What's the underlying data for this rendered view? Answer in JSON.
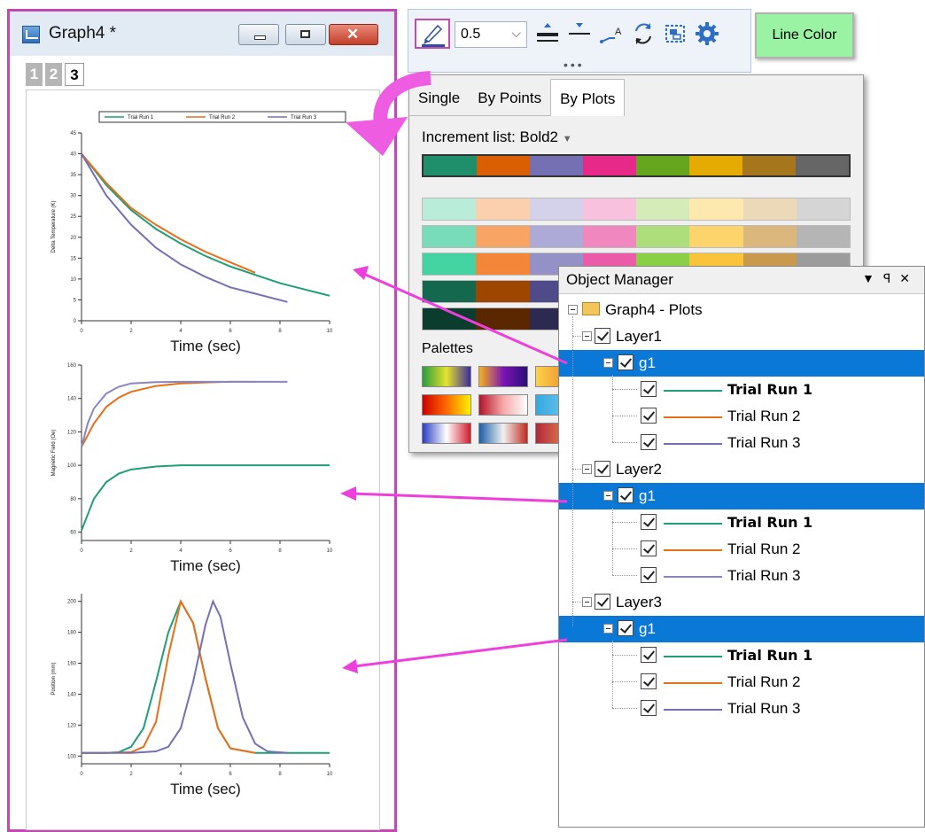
{
  "graph_window": {
    "title": "Graph4 *",
    "layer_tabs": [
      "1",
      "2",
      "3"
    ]
  },
  "style_toolbar": {
    "thickness": "0.5",
    "icons": [
      "pen-color-icon",
      "line-thicker-icon",
      "line-thinner-icon",
      "line-label-icon",
      "swap-icon",
      "group-icon",
      "settings-icon"
    ],
    "line_color_button": "Line Color"
  },
  "increment_panel": {
    "tabs": [
      "Single",
      "By Points",
      "By Plots"
    ],
    "active_tab": "By Plots",
    "increment_label": "Increment list: Bold2",
    "selected_list": [
      "#1f8e6a",
      "#d95f02",
      "#7570b3",
      "#e7298a",
      "#66a61e",
      "#e6ab02",
      "#a6761d",
      "#666666"
    ],
    "shade_rows": [
      [
        "#b9ecd9",
        "#fbd0ae",
        "#d4d2eb",
        "#f8c2de",
        "#d5ecb8",
        "#fde9ae",
        "#ecd9b7",
        "#d5d5d5"
      ],
      [
        "#78dcba",
        "#f7a465",
        "#aeaad8",
        "#f088bf",
        "#aedd7c",
        "#fcd46b",
        "#dcb77d",
        "#b5b5b5"
      ],
      [
        "#44d3a2",
        "#f4863a",
        "#9491c7",
        "#ec5ba7",
        "#8bcf45",
        "#f9c43a",
        "#c99a4e",
        "#9c9c9c"
      ],
      [
        "#14684d",
        "#9e4500",
        "#4f4a8a",
        "#ad1664",
        "#477a14",
        "#a97d01",
        "#7a5614",
        "#454545"
      ],
      [
        "#0a3d2d",
        "#5a2700",
        "#2d2a52",
        "#63093a",
        "#28440a",
        "#604700",
        "#44300b",
        "#242424"
      ]
    ],
    "palettes_label": "Palettes"
  },
  "object_manager": {
    "title": "Object Manager",
    "root": "Graph4 - Plots",
    "layers": [
      {
        "name": "Layer1",
        "group": "g1",
        "plots": [
          {
            "name": "Trial Run 1",
            "color": "#1f9e77",
            "bold": true
          },
          {
            "name": "Trial Run 2",
            "color": "#e66f1a",
            "bold": false
          },
          {
            "name": "Trial Run 3",
            "color": "#7570b3",
            "bold": false
          }
        ]
      },
      {
        "name": "Layer2",
        "group": "g1",
        "plots": [
          {
            "name": "Trial Run 1",
            "color": "#1f9e77",
            "bold": true
          },
          {
            "name": "Trial Run 2",
            "color": "#e66f1a",
            "bold": false
          },
          {
            "name": "Trial Run 3",
            "color": "#8a86c0",
            "bold": false
          }
        ]
      },
      {
        "name": "Layer3",
        "group": "g1",
        "plots": [
          {
            "name": "Trial Run 1",
            "color": "#1f9e77",
            "bold": true
          },
          {
            "name": "Trial Run 2",
            "color": "#e66f1a",
            "bold": false
          },
          {
            "name": "Trial Run 3",
            "color": "#7570b3",
            "bold": false
          }
        ]
      }
    ]
  },
  "chart_data": [
    {
      "type": "line",
      "legend": [
        "Trial Run 1",
        "Trial Run 2",
        "Trial Run 3"
      ],
      "xlabel": "Time (sec)",
      "ylabel": "Delta Temperature (K)",
      "xlim": [
        0,
        10
      ],
      "ylim": [
        0,
        45
      ],
      "xticks": [
        "0",
        "2",
        "4",
        "6",
        "8",
        "10"
      ],
      "yticks": [
        "0",
        "5",
        "10",
        "15",
        "20",
        "25",
        "30",
        "35",
        "40",
        "45"
      ],
      "series": [
        {
          "name": "Trial Run 1",
          "color": "#1f9e77",
          "x": [
            0,
            1,
            2,
            3,
            4,
            5,
            6,
            7,
            8,
            9,
            10
          ],
          "y": [
            40,
            32.5,
            26.5,
            22,
            18.5,
            15.5,
            13,
            11,
            9,
            7.5,
            6
          ]
        },
        {
          "name": "Trial Run 2",
          "color": "#e66f1a",
          "x": [
            0,
            1,
            2,
            3,
            4,
            5,
            6,
            7
          ],
          "y": [
            40,
            33,
            27,
            23,
            19.5,
            16.5,
            14,
            11.5
          ]
        },
        {
          "name": "Trial Run 3",
          "color": "#7570b3",
          "x": [
            0,
            1,
            2,
            3,
            4,
            5,
            6,
            7,
            8.3
          ],
          "y": [
            40,
            30,
            23,
            17.5,
            13.5,
            10.5,
            8,
            6.5,
            4.5
          ]
        }
      ]
    },
    {
      "type": "line",
      "xlabel": "Time (sec)",
      "ylabel": "Magnetic Field (Oe)",
      "xlim": [
        0,
        10
      ],
      "ylim": [
        55,
        160
      ],
      "xticks": [
        "0",
        "2",
        "4",
        "6",
        "8",
        "10"
      ],
      "yticks": [
        "60",
        "80",
        "100",
        "120",
        "140",
        "160"
      ],
      "series": [
        {
          "name": "Trial Run 1",
          "color": "#1f9e77",
          "x": [
            0,
            0.5,
            1,
            1.5,
            2,
            3,
            4,
            6,
            8,
            10
          ],
          "y": [
            61,
            80,
            90,
            95,
            97.5,
            99.3,
            100,
            100,
            100,
            100
          ]
        },
        {
          "name": "Trial Run 2",
          "color": "#e66f1a",
          "x": [
            0,
            0.5,
            1,
            1.5,
            2,
            3,
            4,
            5,
            6,
            7
          ],
          "y": [
            111,
            125,
            135,
            140.5,
            144,
            147.5,
            149,
            149.6,
            150,
            150
          ]
        },
        {
          "name": "Trial Run 3",
          "color": "#8a86c0",
          "x": [
            0,
            0.25,
            0.5,
            1,
            1.5,
            2,
            3,
            4,
            6,
            8.3
          ],
          "y": [
            111,
            125,
            134,
            143,
            147,
            149,
            149.8,
            150,
            150,
            150
          ]
        }
      ]
    },
    {
      "type": "line",
      "xlabel": "Time (sec)",
      "ylabel": "Position (mm)",
      "xlim": [
        0,
        10
      ],
      "ylim": [
        95,
        205
      ],
      "xticks": [
        "0",
        "2",
        "4",
        "6",
        "8",
        "10"
      ],
      "yticks": [
        "100",
        "120",
        "140",
        "160",
        "180",
        "200"
      ],
      "series": [
        {
          "name": "Trial Run 1",
          "color": "#1f9e77",
          "x": [
            0,
            1,
            1.5,
            2,
            2.5,
            3,
            3.5,
            4,
            4.5,
            5,
            5.5,
            6,
            7,
            8,
            10
          ],
          "y": [
            102,
            102,
            102.5,
            106,
            118,
            148,
            180,
            200,
            186,
            150,
            118,
            105,
            102,
            102,
            102
          ]
        },
        {
          "name": "Trial Run 2",
          "color": "#e66f1a",
          "x": [
            0,
            1,
            2,
            2.5,
            3,
            3.5,
            4,
            4.5,
            5,
            5.5,
            6,
            7
          ],
          "y": [
            102,
            102,
            102.5,
            106,
            122,
            165,
            200,
            186,
            150,
            118,
            105,
            102
          ]
        },
        {
          "name": "Trial Run 3",
          "color": "#7570b3",
          "x": [
            0,
            1,
            2,
            3,
            3.5,
            4,
            4.5,
            5,
            5.3,
            5.6,
            6,
            6.5,
            7,
            7.5,
            8.3
          ],
          "y": [
            102,
            102,
            102,
            103,
            106,
            118,
            148,
            185,
            200,
            190,
            160,
            125,
            108,
            103,
            102
          ]
        }
      ]
    }
  ]
}
